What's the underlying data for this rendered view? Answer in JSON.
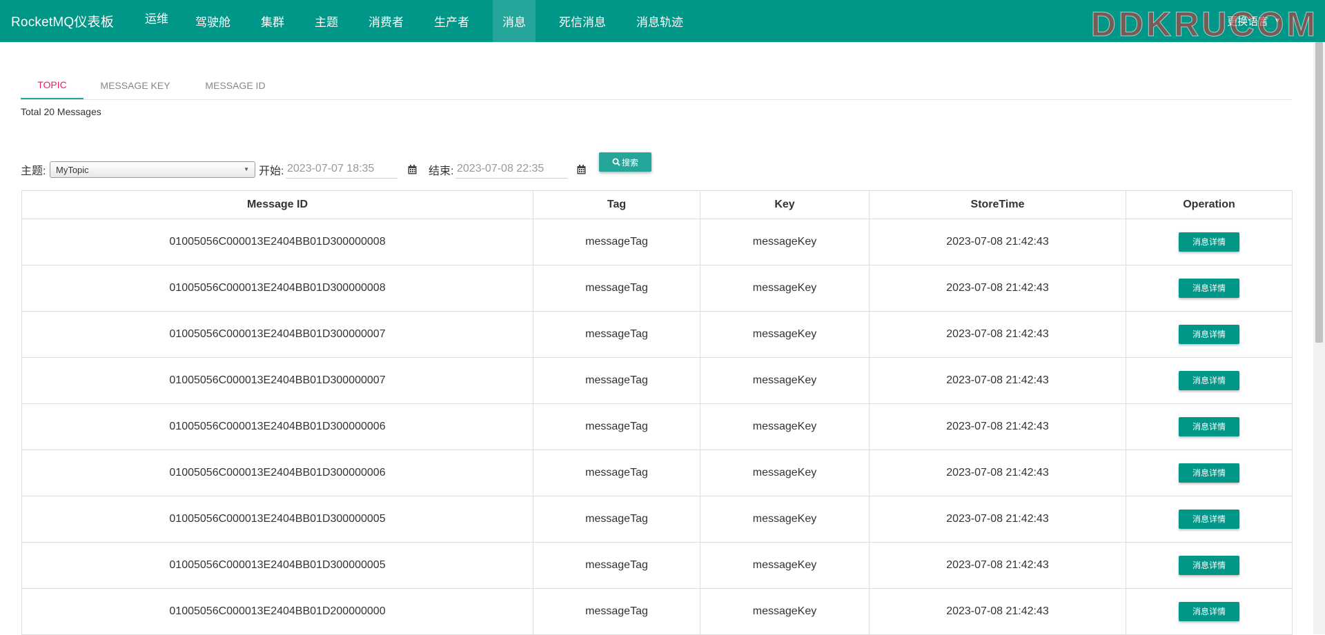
{
  "navbar": {
    "brand": "RocketMQ仪表板",
    "items": [
      {
        "label": "运维"
      },
      {
        "label": "驾驶舱"
      },
      {
        "label": "集群"
      },
      {
        "label": "主题"
      },
      {
        "label": "消费者"
      },
      {
        "label": "生产者"
      },
      {
        "label": "消息",
        "active": true
      },
      {
        "label": "死信消息"
      },
      {
        "label": "消息轨迹"
      }
    ],
    "right_label": "更换语言",
    "watermark": "DDKRUCOM"
  },
  "tabs": [
    {
      "label": "TOPIC",
      "active": true
    },
    {
      "label": "MESSAGE KEY"
    },
    {
      "label": "MESSAGE ID"
    }
  ],
  "total_text": "Total 20 Messages",
  "search": {
    "topic_label": "主题:",
    "topic_value": "MyTopic",
    "start_label": "开始:",
    "start_value": "2023-07-07 18:35",
    "end_label": "结束:",
    "end_value": "2023-07-08 22:35",
    "button_label": "搜索"
  },
  "table": {
    "headers": [
      "Message ID",
      "Tag",
      "Key",
      "StoreTime",
      "Operation"
    ],
    "rows": [
      {
        "id": "01005056C000013E2404BB01D300000008",
        "tag": "messageTag",
        "key": "messageKey",
        "time": "2023-07-08 21:42:43",
        "op": "消息详情"
      },
      {
        "id": "01005056C000013E2404BB01D300000008",
        "tag": "messageTag",
        "key": "messageKey",
        "time": "2023-07-08 21:42:43",
        "op": "消息详情"
      },
      {
        "id": "01005056C000013E2404BB01D300000007",
        "tag": "messageTag",
        "key": "messageKey",
        "time": "2023-07-08 21:42:43",
        "op": "消息详情"
      },
      {
        "id": "01005056C000013E2404BB01D300000007",
        "tag": "messageTag",
        "key": "messageKey",
        "time": "2023-07-08 21:42:43",
        "op": "消息详情"
      },
      {
        "id": "01005056C000013E2404BB01D300000006",
        "tag": "messageTag",
        "key": "messageKey",
        "time": "2023-07-08 21:42:43",
        "op": "消息详情"
      },
      {
        "id": "01005056C000013E2404BB01D300000006",
        "tag": "messageTag",
        "key": "messageKey",
        "time": "2023-07-08 21:42:43",
        "op": "消息详情"
      },
      {
        "id": "01005056C000013E2404BB01D300000005",
        "tag": "messageTag",
        "key": "messageKey",
        "time": "2023-07-08 21:42:43",
        "op": "消息详情"
      },
      {
        "id": "01005056C000013E2404BB01D300000005",
        "tag": "messageTag",
        "key": "messageKey",
        "time": "2023-07-08 21:42:43",
        "op": "消息详情"
      },
      {
        "id": "01005056C000013E2404BB01D200000000",
        "tag": "messageTag",
        "key": "messageKey",
        "time": "2023-07-08 21:42:43",
        "op": "消息详情"
      }
    ]
  },
  "colors": {
    "primary": "#009688",
    "active_nav": "#26a69a",
    "active_tab_text": "#e91e63"
  }
}
